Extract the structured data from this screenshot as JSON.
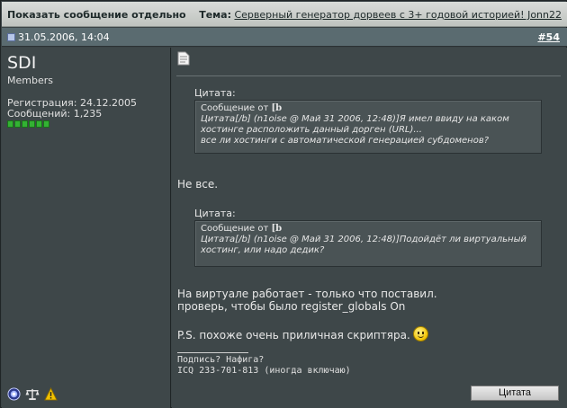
{
  "header": {
    "title": "Показать сообщение отдельно",
    "topic_label": "Тема:",
    "topic_link": "Серверный генератор дорвеев с 3+ годовой историей! Jonn22"
  },
  "post_meta": {
    "date": "31.05.2006, 14:04",
    "post_number": "#54"
  },
  "user": {
    "name": "SDI",
    "group": "Members",
    "registration": "Регистрация: 24.12.2005",
    "posts": "Сообщений: 1,235",
    "reputation_bars": 6,
    "icons": [
      "online-status-icon",
      "scales-icon",
      "warning-icon"
    ]
  },
  "post": {
    "quote1": {
      "label": "Цитата:",
      "from": "Сообщение от ",
      "from_bold": "[b",
      "lines": [
        "Цитата[/b] (n1oise @ Май 31 2006, 12:48)]Я имел ввиду на каком",
        "хостинге расположить данный дорген (URL)...",
        "все ли хостинги с автоматической генерацией субдоменов?"
      ]
    },
    "reply1": "Не все.",
    "quote2": {
      "label": "Цитата:",
      "from": "Сообщение от ",
      "from_bold": "[b",
      "lines": [
        "Цитата[/b] (n1oise @ Май 31 2006, 12:48)]Подойдёт ли виртуальный",
        "хостинг, или надо дедик?"
      ]
    },
    "reply2_line1": "На виртуале работает - только что поставил.",
    "reply2_line2": "проверь, чтобы было register_globals On",
    "ps": "P.S. похоже очень приличная скриптяра.",
    "signature_line1": "Подпись? Нафига?",
    "signature_line2": "ICQ 233-701-813 (иногда включаю)",
    "quote_button": "Цитата"
  },
  "colors": {
    "background": "#3b4446",
    "title_bar": "#c9ccc9",
    "date_bar": "#5a6b70",
    "quote_box": "#4a5355",
    "reputation": "#33b233"
  }
}
